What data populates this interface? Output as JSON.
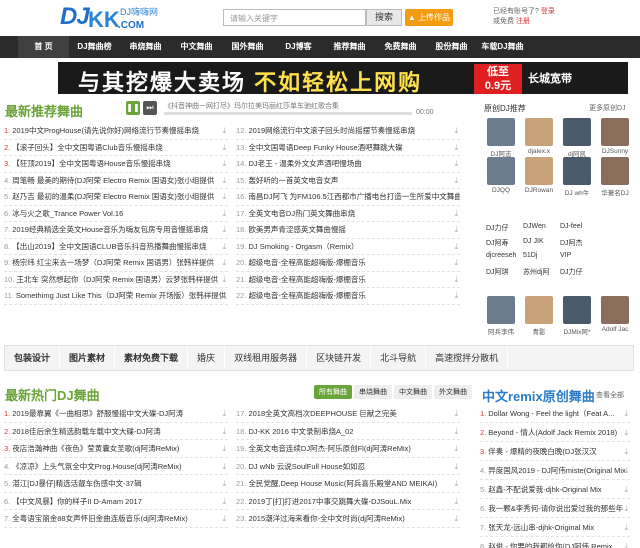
{
  "header": {
    "logo_main": "DJ",
    "logo_kk": "KK",
    "logo_sub": "DJ嗨嗨网",
    "logo_com": ".COM",
    "search_placeholder": "请输入关键字",
    "search_label": "搜索",
    "upload_label": "上传作品",
    "login_line1": "已经有账号了?",
    "login_link": "登录",
    "login_line2": "或免费",
    "register_link": "注册"
  },
  "nav": [
    "首 页",
    "DJ舞曲榜",
    "串烧舞曲",
    "中文舞曲",
    "国外舞曲",
    "DJ博客",
    "推荐舞曲",
    "免费舞曲",
    "股份舞曲",
    "车载DJ舞曲"
  ],
  "banner": {
    "text1": "与其挖爆大卖场",
    "text2": "不如轻松上网购",
    "red_top": "低至",
    "red_bottom": "0.9元",
    "brand": "长城宽带"
  },
  "recommend": {
    "title": "最新推荐舞曲",
    "player_title": "《抖音神曲一网打尽》玛尔拉美玛丽红莎单车驰红歌合集",
    "player_time": "00:00",
    "left_songs": [
      {
        "num": "1.",
        "title": "2019中文ProgHouse(请先说你好)网络流行节奏慢摇串烧"
      },
      {
        "num": "2.",
        "title": "【滚子回头】全中文国粤语Club音乐慢摇串烧"
      },
      {
        "num": "3.",
        "title": "【狂顶2019】全中文国粤语House音乐慢摇串烧"
      },
      {
        "num": "4.",
        "title": "周笔畅 最美的期待(DJ阿荣 Electro Remix 国语女)张小组提供"
      },
      {
        "num": "5.",
        "title": "赵乃吉 最初的温柔(DJ阿荣 Electro Remix 国语女)张小组提供"
      },
      {
        "num": "6.",
        "title": "冰与火之歌_Trance Power Vol.16"
      },
      {
        "num": "7.",
        "title": "2019经典精选全英文House音乐为嗨友包房专用音慢摇串烧"
      },
      {
        "num": "8.",
        "title": "【出山2019】全中文国语CLUB音乐抖音热播舞曲慢摇串烧"
      },
      {
        "num": "9.",
        "title": "杨宗纬 红尘来去一场梦（DJ阿荣 Remix 国语男）张韩祥提供"
      },
      {
        "num": "10.",
        "title": "王北车 突然想起你（DJ阿荣 Remix 国语男）云梦张韩祥提供"
      },
      {
        "num": "11.",
        "title": "Somethimg Just Like This（DJ阿荣 Remix 开场版）张韩祥提供"
      }
    ],
    "right_songs": [
      {
        "num": "12.",
        "title": "2019网络流行中文滚子回头时尚摇摆节奏慢摇串烧"
      },
      {
        "num": "13.",
        "title": "全中文国粤语Deep Funky House酒吧舞跳大碟"
      },
      {
        "num": "14.",
        "title": "DJ老王 - 温柔外文女声酒吧慢场曲"
      },
      {
        "num": "15.",
        "title": "轰好听的一首英文电音女声"
      },
      {
        "num": "16.",
        "title": "南昌DJ阿飞 为FM106.5江西都市广播电台打造一生所爱中文舞曲"
      },
      {
        "num": "17.",
        "title": "全英文电音DJ热门英文舞曲串烧"
      },
      {
        "num": "18.",
        "title": "欧美男声青涩感英文舞曲慢摇"
      },
      {
        "num": "19.",
        "title": "DJ Smoking - Orgasm（Remix）"
      },
      {
        "num": "20.",
        "title": "超级电音-全程高能超嗨版-爆棚音乐"
      },
      {
        "num": "21.",
        "title": "超级电音-全程高能超嗨版-爆棚音乐"
      },
      {
        "num": "22.",
        "title": "超级电音-全程高能超嗨版-爆棚音乐"
      }
    ]
  },
  "original_dj": {
    "title": "原创DJ推荐",
    "more": "更多原创DJ",
    "row1": [
      "DJ阿志",
      "djalex.x",
      "dj阿凯",
      "DJSunny"
    ],
    "row2": [
      "DJQQ",
      "DJRowan",
      "DJ wh牛",
      "华著名DJ"
    ],
    "names": [
      [
        "DJ力仔",
        "DJWen",
        "DJ-feel"
      ],
      [
        "DJ阿寿",
        "DJ JIK",
        "DJ阿杰"
      ],
      [
        "djcreeseh",
        "51Dj",
        "VIP"
      ],
      [
        "DJ阿琪",
        "苏州dj阿",
        "DJ力仔"
      ]
    ],
    "row3": [
      "阿兵李伟",
      "青影",
      "DJMix阿*",
      "Adolf Jac"
    ]
  },
  "links": [
    "包装设计",
    "图片素材",
    "素材免费下载",
    "婚庆",
    "双线租用服务器",
    "区块链开发",
    "北斗导航",
    "高速搅拌分散机"
  ],
  "hot": {
    "title": "最新热门DJ舞曲",
    "tabs": [
      "所有舞曲",
      "串烧舞曲",
      "中文舞曲",
      "外文舞曲"
    ],
    "left_songs": [
      {
        "num": "1.",
        "title": "2019最靠翼《一曲相思》舒服慢摇中文大碟-DJ阿涛"
      },
      {
        "num": "2.",
        "title": "2018佳后余生精选韵载车载中文大碟-DJ阿涛"
      },
      {
        "num": "3.",
        "title": "夜店浩瀚神曲《夜色》莹黄囊女圣歌(dj阿涛ReMix)"
      },
      {
        "num": "4.",
        "title": "《凉凉》上头气氛全中文Prog.House(dj阿涛ReMix)"
      },
      {
        "num": "5.",
        "title": "湛江[DJ暴仔]精选活靓车伤感中文-37辑"
      },
      {
        "num": "6.",
        "title": "【中文风暴】你的样子II D-Amam 2017"
      },
      {
        "num": "7.",
        "title": "全粤语宝丽金88女声怀旧金曲连版音乐(dj阿涛ReMix)"
      }
    ],
    "right_songs": [
      {
        "num": "17.",
        "title": "2018全英文高档次DEEPHOUSE 巨献之完美"
      },
      {
        "num": "18.",
        "title": "DJ-KK 2016 中文录制串烧A_02"
      },
      {
        "num": "19.",
        "title": "全英文电音连续DJ阿杰-阿乐原创Fl(dj阿涛ReMix)"
      },
      {
        "num": "20.",
        "title": "DJ wNb 云说SoulFull House如如忍"
      },
      {
        "num": "21.",
        "title": "全民党醒,Deep House Music(阿兵喜乐殿堂AND MEIKAI)"
      },
      {
        "num": "22.",
        "title": "2019丁[打]打进2017中事交跳舞大碟-DJSouL.Mix"
      },
      {
        "num": "23.",
        "title": "2015潮洋过海来看你-全中文时尚(dj阿涛ReMix)"
      }
    ]
  },
  "remix": {
    "title": "中文remix原创舞曲",
    "more": "查看全部",
    "songs": [
      {
        "num": "1.",
        "title": "Dollar Wong - Feel the light（Feat A..."
      },
      {
        "num": "2.",
        "title": "Beyond - 情人(Adolf Jack Remix 2018)"
      },
      {
        "num": "3.",
        "title": "伴奏 - 爆精的夜晚白晚(DJ张汉汉"
      },
      {
        "num": "4.",
        "title": "异度国风2019 - DJ阿伟miste(Original Mix"
      },
      {
        "num": "5.",
        "title": "赵鑫-不配说爱我-djhk-Original Mix"
      },
      {
        "num": "6.",
        "title": "我一颗&李秀何-请你说出爱过我的那些年"
      },
      {
        "num": "7.",
        "title": "张天龙-远山串-djhk-Original Mix"
      },
      {
        "num": "8.",
        "title": "赵俊 - 你要的我都给你(DJ阿伟 Remix..."
      }
    ]
  }
}
